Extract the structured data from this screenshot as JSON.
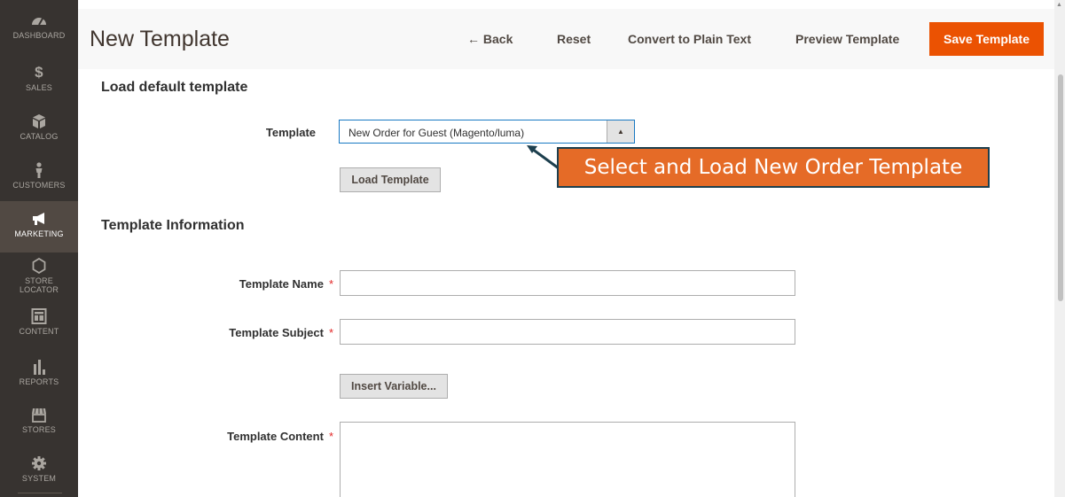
{
  "sidebar": {
    "items": [
      {
        "label": "DASHBOARD",
        "icon": "dashboard-icon"
      },
      {
        "label": "SALES",
        "icon": "dollar-icon"
      },
      {
        "label": "CATALOG",
        "icon": "cube-icon"
      },
      {
        "label": "CUSTOMERS",
        "icon": "person-icon"
      },
      {
        "label": "MARKETING",
        "icon": "megaphone-icon",
        "active": true
      },
      {
        "label": "STORE",
        "label2": "LOCATOR",
        "icon": "hexagon-icon"
      },
      {
        "label": "CONTENT",
        "icon": "layout-icon"
      },
      {
        "label": "REPORTS",
        "icon": "bar-chart-icon"
      },
      {
        "label": "STORES",
        "icon": "store-icon"
      },
      {
        "label": "SYSTEM",
        "icon": "gear-icon"
      }
    ]
  },
  "header": {
    "title": "New Template",
    "back_label": "← Back",
    "reset_label": "Reset",
    "convert_label": "Convert to Plain Text",
    "preview_label": "Preview Template",
    "save_label": "Save Template"
  },
  "load_section": {
    "title": "Load default template",
    "template_label": "Template",
    "template_value": "New Order for Guest (Magento/luma)",
    "load_button": "Load Template"
  },
  "info_section": {
    "title": "Template Information",
    "name_label": "Template Name",
    "subject_label": "Template Subject",
    "insert_variable_button": "Insert Variable...",
    "content_label": "Template Content",
    "required_marker": "*"
  },
  "callout": {
    "text": "Select and Load New Order Template"
  },
  "colors": {
    "sidebar_bg": "#373330",
    "sidebar_active": "#514943",
    "accent": "#eb5202",
    "callout_bg": "#e56b27",
    "callout_border": "#1d3f4e",
    "required": "#e22626"
  }
}
